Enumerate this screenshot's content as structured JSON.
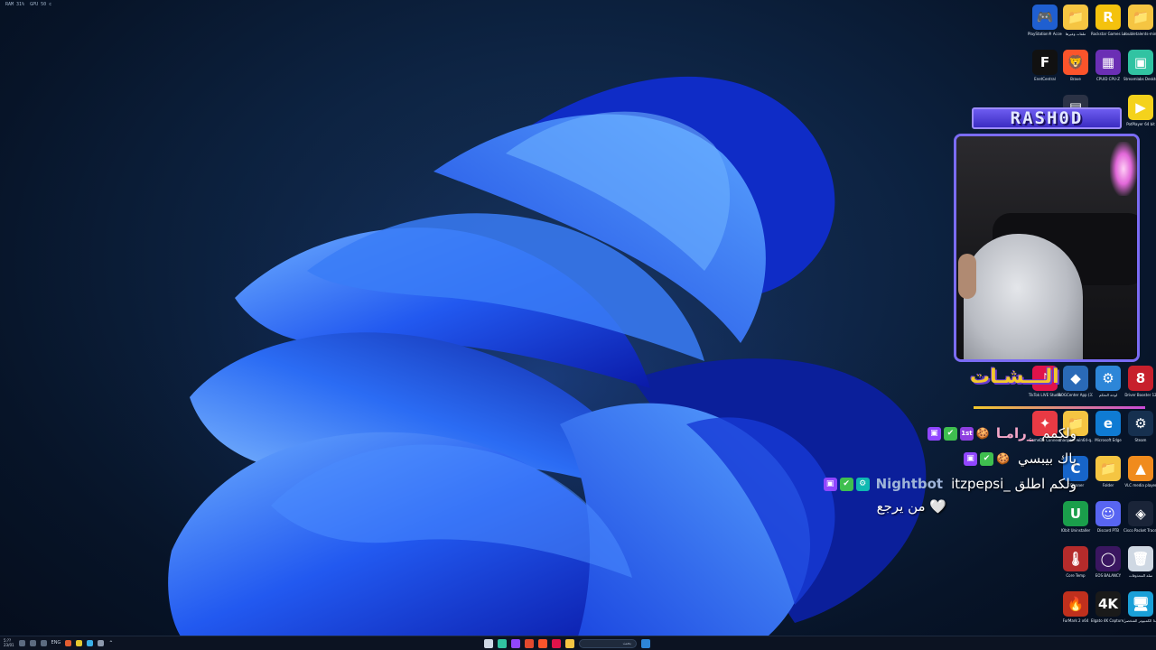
{
  "perf_overlay": {
    "ram": "RAM 31%",
    "gpu": "GPU 50 c"
  },
  "desktop_icons": [
    {
      "label": "PlayStation® Accessories",
      "icon": "gamepad-icon",
      "color": "#1f5fd1",
      "glyph": "🎮"
    },
    {
      "label": "ملفات وغيرها",
      "icon": "folder-icon",
      "color": "#f5c542",
      "glyph": "📁"
    },
    {
      "label": "Rockstar Games Launcher",
      "icon": "rockstar-icon",
      "color": "#f4c20d",
      "glyph": "R"
    },
    {
      "label": "doubletalents-mini...",
      "icon": "folder-icon",
      "color": "#f5c542",
      "glyph": "📁"
    },
    {
      "label": "EnetCentral",
      "icon": "f-logo-icon",
      "color": "#111111",
      "glyph": "F"
    },
    {
      "label": "Brave",
      "icon": "brave-icon",
      "color": "#fb542b",
      "glyph": "🦁"
    },
    {
      "label": "CPUID CPU-Z",
      "icon": "cpu-icon",
      "color": "#6b2fb4",
      "glyph": "▦"
    },
    {
      "label": "Streamlabs Desktop",
      "icon": "streamlabs-icon",
      "color": "#31c3a2",
      "glyph": "▣"
    },
    {
      "label": "Manager",
      "icon": "app-icon",
      "color": "#2b3245",
      "glyph": "▤"
    },
    {
      "label": "PotPlayer 64 bit",
      "icon": "play-icon",
      "color": "#f4d21c",
      "glyph": "▶"
    },
    {
      "label": "TikTok LIVE Studio",
      "icon": "tiktok-icon",
      "color": "#e0134a",
      "glyph": "♪"
    },
    {
      "label": "ROGCenter App (33 3.3)",
      "icon": "rog-icon",
      "color": "#2a6ab7",
      "glyph": "◆"
    },
    {
      "label": "لوحة التحكم",
      "icon": "control-panel-icon",
      "color": "#2d86d8",
      "glyph": "⚙"
    },
    {
      "label": "Driver Booster 12",
      "icon": "driver-booster-icon",
      "color": "#c7202c",
      "glyph": "8"
    },
    {
      "label": "GameDo Connect",
      "icon": "connect-icon",
      "color": "#e83a44",
      "glyph": "✦"
    },
    {
      "label": "shadperk-win64-q...",
      "icon": "folder-icon",
      "color": "#f5c542",
      "glyph": "📁"
    },
    {
      "label": "Microsoft Edge",
      "icon": "edge-icon",
      "color": "#0f7bd3",
      "glyph": "e"
    },
    {
      "label": "Steam",
      "icon": "steam-icon",
      "color": "#16304f",
      "glyph": "⚙"
    },
    {
      "label": "CCleaner",
      "icon": "ccleaner-icon",
      "color": "#1765c9",
      "glyph": "C"
    },
    {
      "label": "Folder",
      "icon": "folder-icon",
      "color": "#f5c542",
      "glyph": "📁"
    },
    {
      "label": "VLC media player",
      "icon": "vlc-icon",
      "color": "#f08b1d",
      "glyph": "▲"
    },
    {
      "label": "IObit Uninstaller",
      "icon": "uninstaller-icon",
      "color": "#1a9e4b",
      "glyph": "U"
    },
    {
      "label": "Discord PTB",
      "icon": "discord-icon",
      "color": "#5865f2",
      "glyph": "☺"
    },
    {
      "label": "Cisco Packet Tracer",
      "icon": "packet-tracer-icon",
      "color": "#1a2438",
      "glyph": "◈"
    },
    {
      "label": "Core Temp",
      "icon": "core-temp-icon",
      "color": "#b52b2b",
      "glyph": "🌡"
    },
    {
      "label": "EOS BALANCY",
      "icon": "ring-icon",
      "color": "#3a1660",
      "glyph": "◯"
    },
    {
      "label": "سلة المحذوفات",
      "icon": "recycle-bin-icon",
      "color": "#cfd8e3",
      "glyph": "🗑"
    },
    {
      "label": "FurMark 2 x64",
      "icon": "furmark-icon",
      "color": "#c0301d",
      "glyph": "🔥"
    },
    {
      "label": "Elgato 4K Capture Utility",
      "icon": "elgato-icon",
      "color": "#1a1a1a",
      "glyph": "4K"
    },
    {
      "label": "هذا الكمبيوتر الشخصي",
      "icon": "this-pc-icon",
      "color": "#1aa0d8",
      "glyph": "🖥"
    }
  ],
  "stream_overlay": {
    "banner_text": "RASH0D",
    "chat_title": "الـــشـات",
    "colors": {
      "accent_purple": "#7b6cf5",
      "accent_yellow": "#f3c82c"
    }
  },
  "chat": [
    {
      "badges": [
        "twitch",
        "verified",
        "sub-1st",
        "emote"
      ],
      "name": "رامـا_",
      "name_color": "#f6a7c8",
      "message": "ولكمم"
    },
    {
      "badges": [
        "twitch",
        "verified",
        "emote"
      ],
      "name": "",
      "name_color": "#ffffff",
      "message": "باك بيبسي"
    },
    {
      "badges": [
        "twitch",
        "verified",
        "bot"
      ],
      "name": "Nightbot",
      "name_color": "#9fb4d8",
      "message": "itzpepsi_ ولكم اطلق"
    },
    {
      "badges": [],
      "name": "",
      "name_color": "#ffffff",
      "message": "من يرجع 🤍"
    }
  ],
  "taskbar": {
    "time": "5:??",
    "date": "23/01",
    "lang": "ENG",
    "search_placeholder": "بحث"
  }
}
